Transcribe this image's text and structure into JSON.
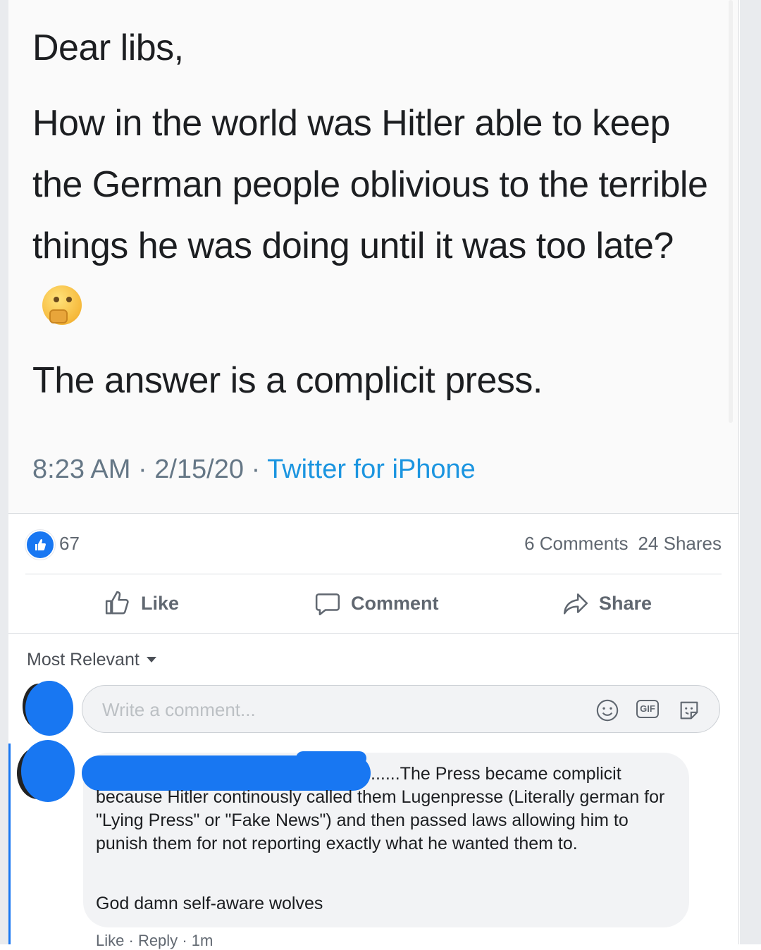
{
  "tweet": {
    "greeting": "Dear libs,",
    "body": "How in the world was Hitler able to keep the German people oblivious to the terrible things he was doing until it was too late?",
    "emoji_name": "thinking-face-icon",
    "conclusion": "The answer is a complicit press.",
    "time": "8:23 AM",
    "date": "2/15/20",
    "separator": "·",
    "source": "Twitter for iPhone"
  },
  "reactions": {
    "like_count": "67",
    "comments": "6 Comments",
    "shares": "24 Shares"
  },
  "actions": {
    "like": "Like",
    "comment": "Comment",
    "share": "Share"
  },
  "comments_section": {
    "sort_label": "Most Relevant",
    "composer_placeholder": "Write a comment...",
    "gif_label": "GIF",
    "comment": {
      "text_first": "......The Press became complicit",
      "text_rest": "because Hitler continously called them Lugenpresse (Literally german for \"Lying Press\" or \"Fake News\") and then passed laws allowing him to punish them for not reporting exactly what he wanted them to.",
      "text_extra": "God damn self-aware wolves",
      "action_like": "Like",
      "action_reply": "Reply",
      "action_separator": "·",
      "age": "1m"
    }
  },
  "colors": {
    "facebook_blue": "#1877f2",
    "twitter_link": "#1b95e0",
    "meta_gray": "#657786"
  }
}
